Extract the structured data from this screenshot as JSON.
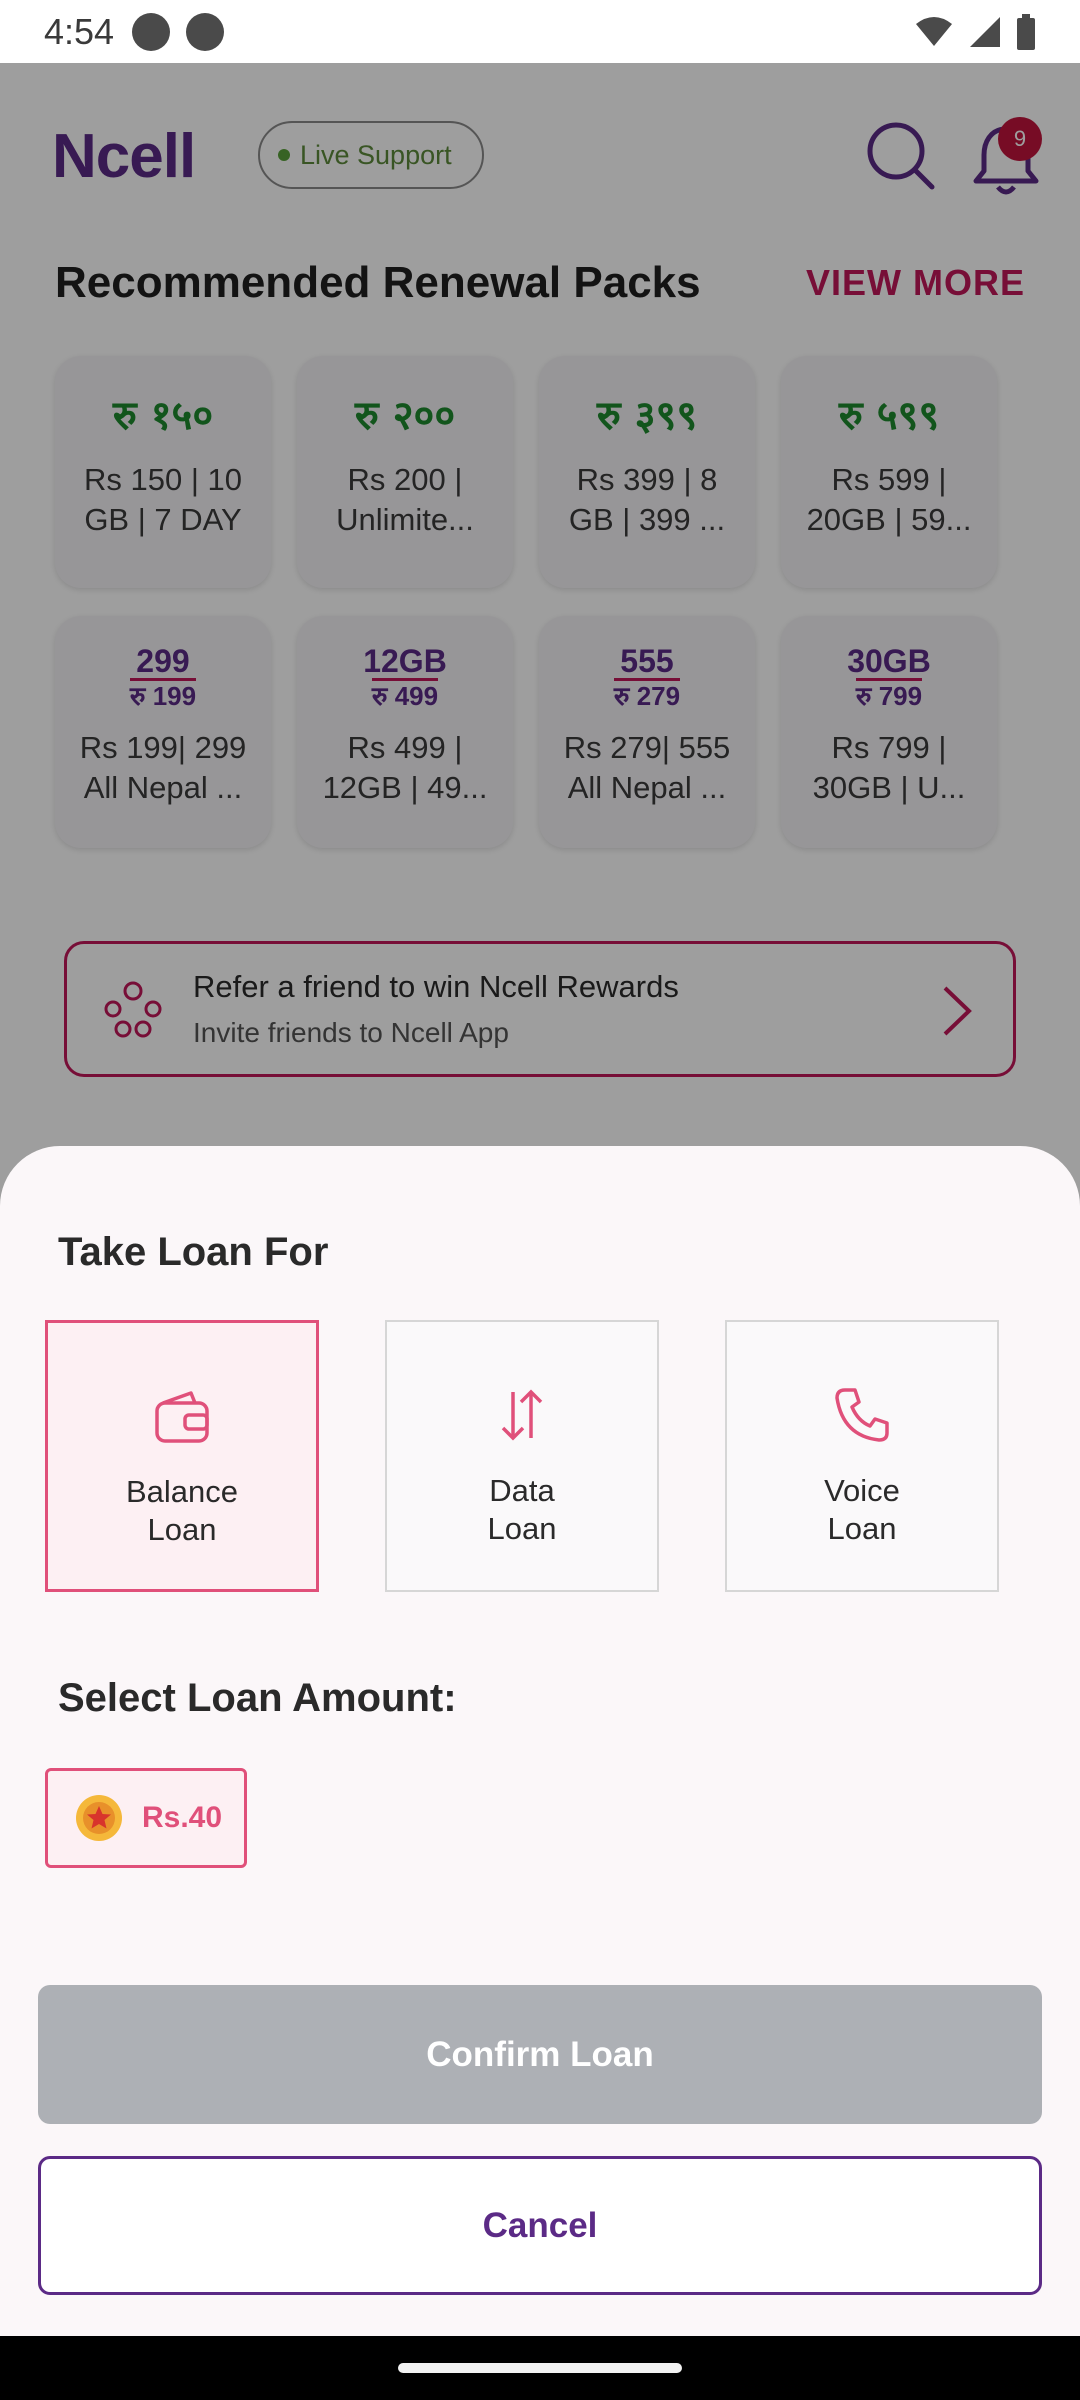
{
  "status_bar": {
    "time": "4:54"
  },
  "app": {
    "logo": "Ncell",
    "live_support": "Live Support",
    "notification_count": "9",
    "section_title": "Recommended Renewal Packs",
    "view_more": "VIEW MORE",
    "packs": [
      {
        "price_glyph": "रु १५०",
        "label": "Rs 150 | 10 GB | 7 DAY"
      },
      {
        "price_glyph": "रु २००",
        "label": "Rs 200 | Unlimite..."
      },
      {
        "price_glyph": "रु ३९९",
        "label": "Rs 399 | 8 GB | 399 ..."
      },
      {
        "price_glyph": "रु ५९९",
        "label": "Rs 599 | 20GB | 59..."
      },
      {
        "badge_top": "299",
        "badge_bottom": "रु 199",
        "label": "Rs 199| 299 All Nepal ..."
      },
      {
        "badge_top": "12GB",
        "badge_bottom": "रु 499",
        "label": "Rs 499 | 12GB | 49..."
      },
      {
        "badge_top": "555",
        "badge_bottom": "रु 279",
        "label": "Rs 279| 555 All Nepal ..."
      },
      {
        "badge_top": "30GB",
        "badge_bottom": "रु 799",
        "label": "Rs 799 | 30GB | U..."
      }
    ],
    "refer": {
      "title": "Refer a friend to win Ncell Rewards",
      "subtitle": "Invite friends to Ncell App"
    }
  },
  "sheet": {
    "title": "Take Loan For",
    "loan_types": [
      {
        "label": "Balance\nLoan",
        "icon": "wallet-icon",
        "selected": true
      },
      {
        "label": "Data\nLoan",
        "icon": "data-arrows-icon",
        "selected": false
      },
      {
        "label": "Voice\nLoan",
        "icon": "phone-icon",
        "selected": false
      }
    ],
    "amount_title": "Select Loan Amount:",
    "amount": "Rs.40",
    "confirm_label": "Confirm Loan",
    "cancel_label": "Cancel"
  },
  "colors": {
    "brand_purple": "#5b2a86",
    "accent_pink": "#e0507a",
    "disabled_gray": "#adb0b5"
  }
}
